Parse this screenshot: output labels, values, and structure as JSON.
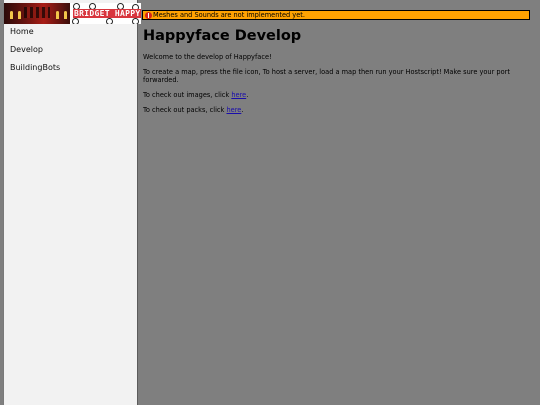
{
  "banner": {
    "logo_text": "BRIDGET HAPPY NEW"
  },
  "sidebar": {
    "items": [
      {
        "label": "Home"
      },
      {
        "label": "Develop"
      },
      {
        "label": "BuildingBots"
      }
    ]
  },
  "notice": {
    "text": "Meshes and Sounds are not implemented yet."
  },
  "main": {
    "title": "Happyface Develop",
    "welcome": "Welcome to the develop of Happyface!",
    "instructions": "To create a map, press the file icon, To host a server, load a map then run your Hostscript! Make sure your port forwarded.",
    "images_prefix": "To check out images, click ",
    "images_link": "here",
    "images_suffix": ".",
    "packs_prefix": "To check out packs, click ",
    "packs_link": "here",
    "packs_suffix": "."
  },
  "colors": {
    "background": "#7f7f7f",
    "sidebar": "#f2f2f2",
    "notice": "#ffa202",
    "link": "#1a0dab"
  }
}
